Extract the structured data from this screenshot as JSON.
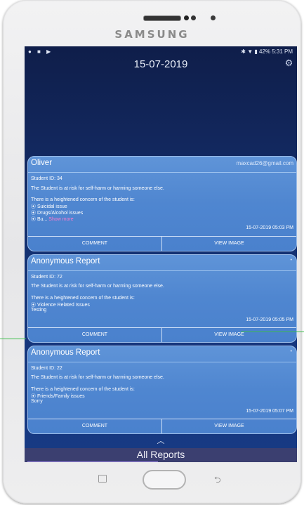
{
  "device": {
    "brand": "SAMSUNG"
  },
  "statusbar": {
    "left_icons": "● ■ ▶",
    "right": "✱ ▼ ▮ 42% 5:31 PM"
  },
  "header": {
    "date": "15-07-2019",
    "settings_icon": "⚙"
  },
  "cards": [
    {
      "title": "Oliver",
      "email": "maxcad26@gmail.com",
      "student_id": "Student ID: 34",
      "risk": "The Student is at risk for self-harm or harming someone else.",
      "concern_intro": "There is a heightened concern of the student is:",
      "issues": [
        "⦿ Suicidal issue",
        "⦿ Drugs/Alcohol issues",
        "⦿ Bu... "
      ],
      "more": "Show more",
      "timestamp": "15-07-2019 05:03 PM",
      "comment": "COMMENT",
      "view": "VIEW IMAGE"
    },
    {
      "title": "Anonymous Report",
      "student_id": "Student ID: 72",
      "risk": "The Student is at risk for self-harm or harming someone else.",
      "concern_intro": "There is a heightened concern of the student is:",
      "issues": [
        "⦿ Violence Related Issues",
        "Testing"
      ],
      "timestamp": "15-07-2019 05:05 PM",
      "comment": "COMMENT",
      "view": "VIEW IMAGE"
    },
    {
      "title": "Anonymous Report",
      "student_id": "Student ID: 22",
      "risk": "The Student is at risk for self-harm or harming someone else.",
      "concern_intro": "There is a heightened concern of the student is:",
      "issues": [
        "⦿ Friends/Family issues",
        "Sorry"
      ],
      "timestamp": "15-07-2019 05:07 PM",
      "comment": "COMMENT",
      "view": "VIEW IMAGE"
    }
  ],
  "footer": {
    "chevron": "︿",
    "label": "All Reports"
  },
  "navbar": {
    "back_icon": "⮌"
  }
}
